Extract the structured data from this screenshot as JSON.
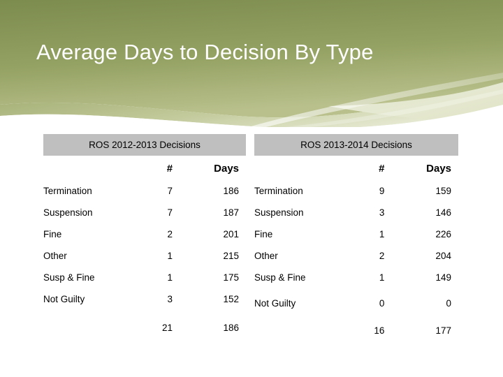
{
  "slide": {
    "title": "Average Days to Decision By Type"
  },
  "tables": [
    {
      "id": "ros-2012-2013",
      "banner": "ROS 2012-2013 Decisions",
      "columns": [
        "",
        "#",
        "Days"
      ],
      "rows": [
        {
          "label": "Termination",
          "count": "7",
          "days": "186"
        },
        {
          "label": "Suspension",
          "count": "7",
          "days": "187"
        },
        {
          "label": "Fine",
          "count": "2",
          "days": "201"
        },
        {
          "label": "Other",
          "count": "1",
          "days": "215"
        },
        {
          "label": "Susp & Fine",
          "count": "1",
          "days": "175"
        },
        {
          "label": "Not Guilty",
          "count": "3",
          "days": "152"
        }
      ],
      "total": {
        "label": "",
        "count": "21",
        "days": "186"
      }
    },
    {
      "id": "ros-2013-2014",
      "banner": "ROS 2013-2014 Decisions",
      "columns": [
        "",
        "#",
        "Days"
      ],
      "rows": [
        {
          "label": "Termination",
          "count": "9",
          "days": "159"
        },
        {
          "label": "Suspension",
          "count": "3",
          "days": "146"
        },
        {
          "label": "Fine",
          "count": "1",
          "days": "226"
        },
        {
          "label": "Other",
          "count": "2",
          "days": "204"
        },
        {
          "label": "Susp & Fine",
          "count": "1",
          "days": "149"
        },
        {
          "label": "Not Guilty",
          "count": "0",
          "days": "0"
        }
      ],
      "total": {
        "label": "",
        "count": "16",
        "days": "177"
      }
    }
  ],
  "colors": {
    "banner_top": "#8a9a5b",
    "banner_olive": "#a3ac71",
    "banner_light": "#dfe3c4",
    "header_band": "#bfbfbf",
    "title_text": "#ffffff"
  }
}
